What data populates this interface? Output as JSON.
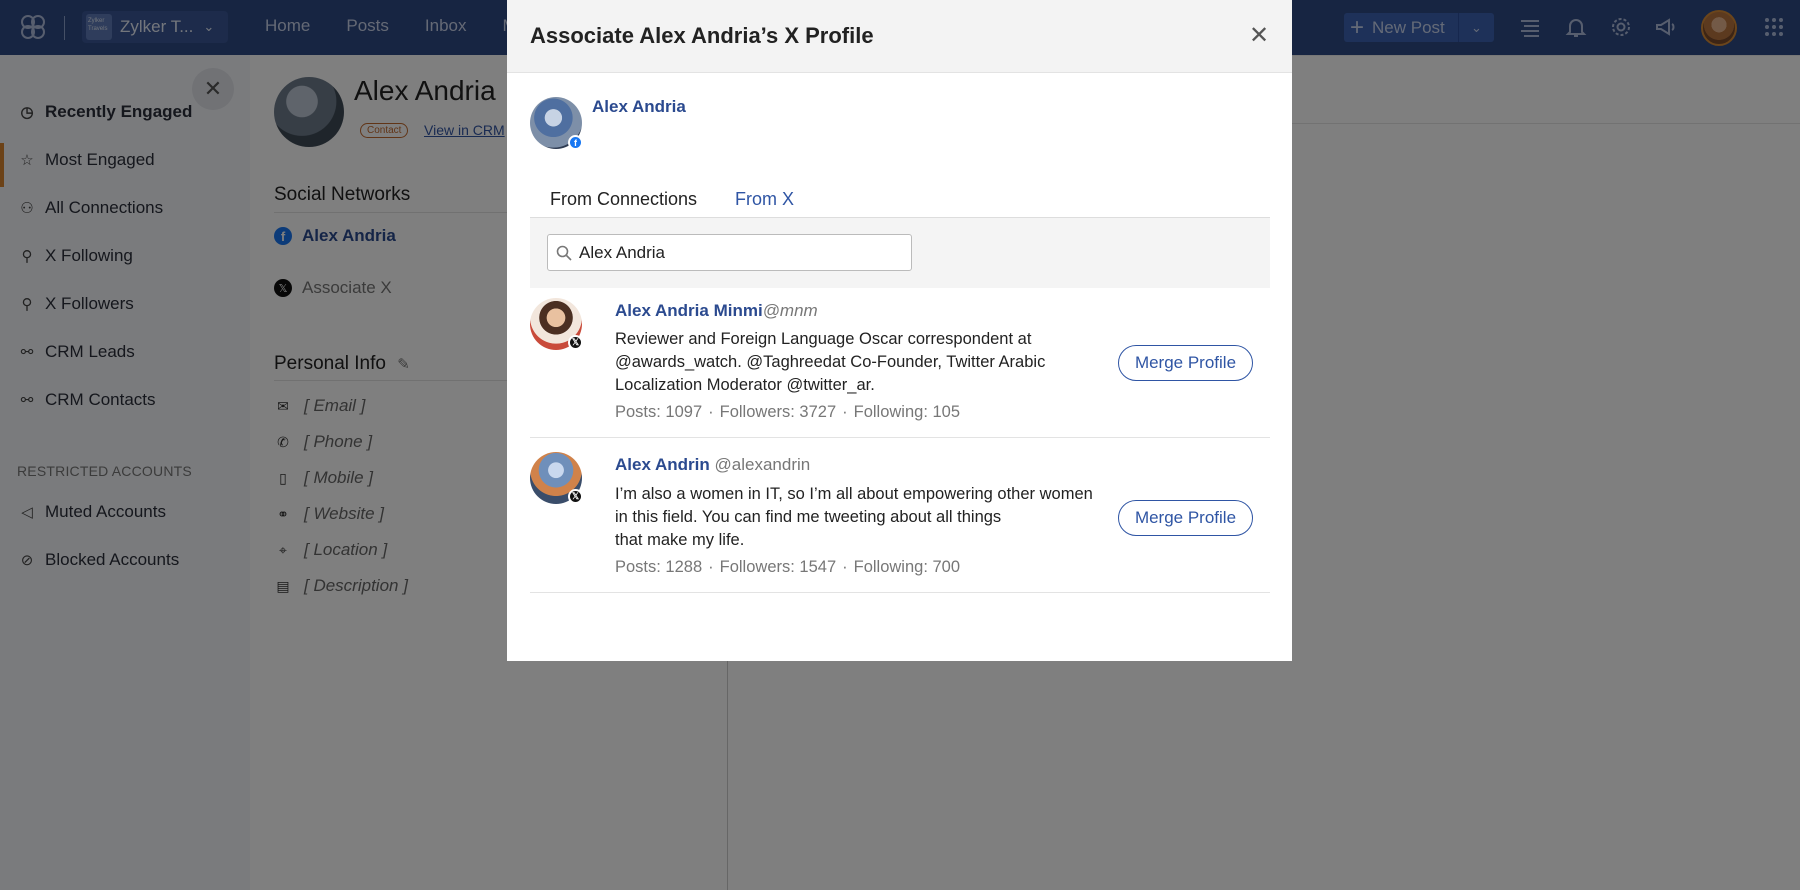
{
  "topbar": {
    "brand_name": "Zylker T...",
    "brand_logo_text": "Zylker Travels",
    "nav": [
      "Home",
      "Posts",
      "Inbox",
      "M"
    ],
    "new_post_label": "New Post"
  },
  "sidebar": {
    "items": [
      {
        "label": "Recently Engaged",
        "icon": "clock-icon",
        "active": true
      },
      {
        "label": "Most Engaged",
        "icon": "star-icon"
      },
      {
        "label": "All Connections",
        "icon": "users-icon"
      },
      {
        "label": "X Following",
        "icon": "user-follow-icon"
      },
      {
        "label": "X Followers",
        "icon": "user-followers-icon"
      },
      {
        "label": "CRM Leads",
        "icon": "handshake-icon"
      },
      {
        "label": "CRM Contacts",
        "icon": "handshake-icon"
      }
    ],
    "restricted_heading": "RESTRICTED ACCOUNTS",
    "restricted_items": [
      {
        "label": "Muted Accounts",
        "icon": "mute-icon"
      },
      {
        "label": "Blocked Accounts",
        "icon": "block-icon"
      }
    ]
  },
  "profile": {
    "name": "Alex Andria",
    "contact_badge": "Contact",
    "view_in_crm": "View in CRM",
    "social_networks_heading": "Social Networks",
    "facebook_name": "Alex Andria",
    "associate_x": "Associate X",
    "personal_info_heading": "Personal Info",
    "fields": [
      "[ Email ]",
      "[ Phone ]",
      "[ Mobile ]",
      "[ Website ]",
      "[ Location ]",
      "[ Description ]"
    ]
  },
  "modal": {
    "title": "Associate Alex Andria’s X Profile",
    "account_name": "Alex Andria",
    "tabs": [
      "From Connections",
      "From X"
    ],
    "search_value": "Alex Andria",
    "results": [
      {
        "name": "Alex Andria Minmi",
        "handle": "@mnm",
        "bio_lines": [
          "Reviewer and Foreign Language Oscar correspondent at",
          "@awards_watch. @Taghreedat Co-Founder, Twitter Arabic",
          "Localization Moderator @twitter_ar."
        ],
        "posts": "Posts: 1097",
        "followers": "Followers: 3727",
        "following": "Following: 105",
        "merge_label": "Merge Profile"
      },
      {
        "name": "Alex Andrin",
        "handle": "@alexandrin",
        "bio_lines": [
          "I’m also a women in IT, so I’m all about empowering other women",
          "in this field. You can find me tweeting about all things",
          "that make my life."
        ],
        "posts": "Posts: 1288",
        "followers": "Followers: 1547",
        "following": "Following: 700",
        "merge_label": "Merge Profile"
      }
    ]
  },
  "colors": {
    "topbar": "#2f4a85",
    "accent_orange": "#e07a2e",
    "link_blue": "#2f55a4",
    "facebook": "#1877f2"
  }
}
